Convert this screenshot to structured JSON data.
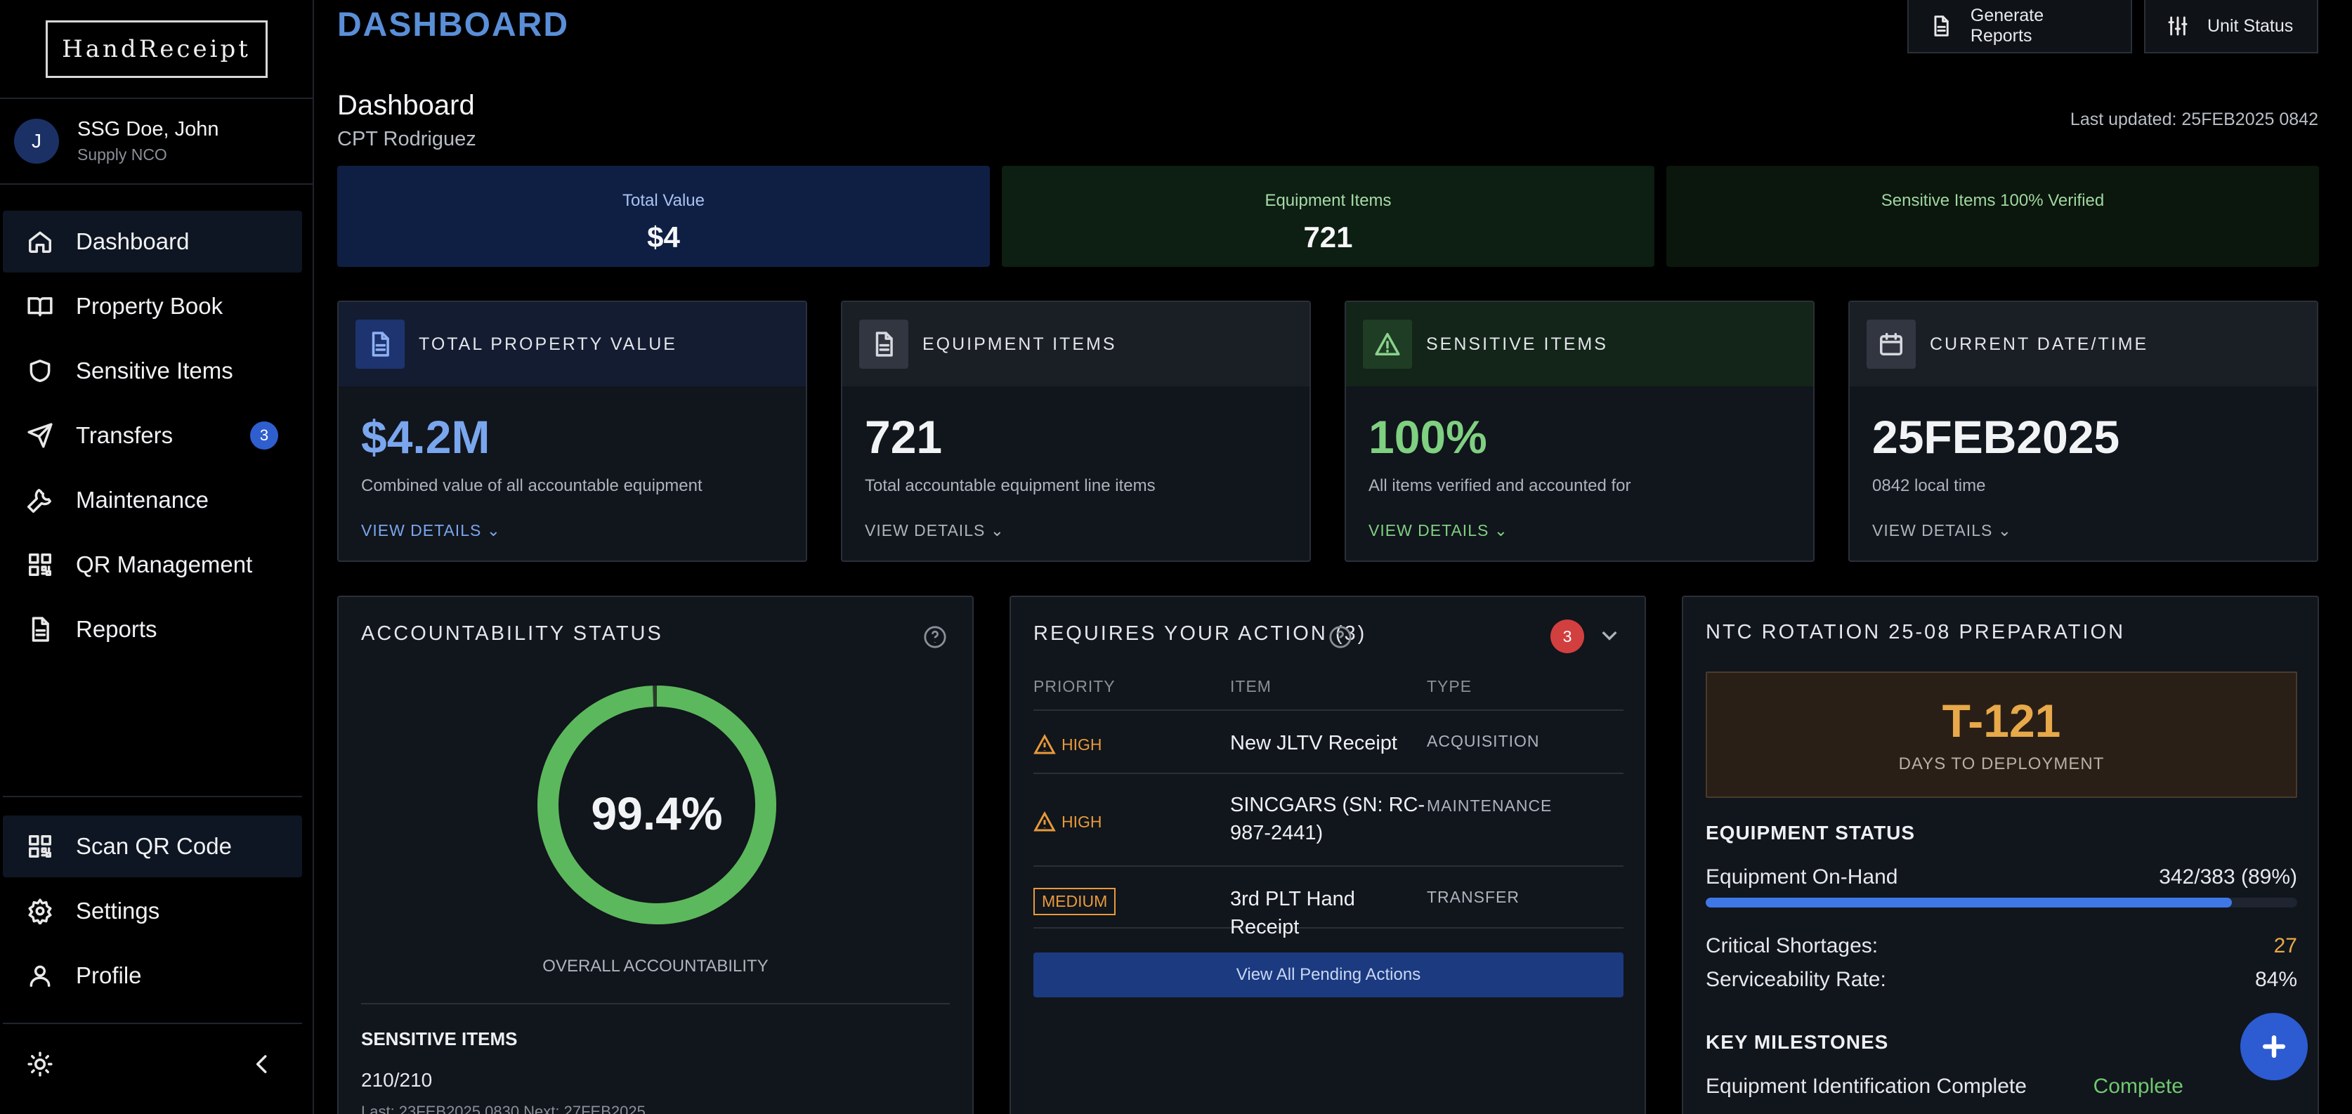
{
  "app": {
    "logo": "HandReceipt"
  },
  "user": {
    "initial": "J",
    "name": "SSG Doe, John",
    "role": "Supply NCO"
  },
  "sidebar": {
    "items": [
      {
        "label": "Dashboard",
        "icon": "home-icon",
        "active": true
      },
      {
        "label": "Property Book",
        "icon": "book-icon"
      },
      {
        "label": "Sensitive Items",
        "icon": "shield-icon"
      },
      {
        "label": "Transfers",
        "icon": "send-icon",
        "badge": "3"
      },
      {
        "label": "Maintenance",
        "icon": "wrench-icon"
      },
      {
        "label": "QR Management",
        "icon": "qr-icon"
      },
      {
        "label": "Reports",
        "icon": "file-icon"
      }
    ],
    "bottom_items": [
      {
        "label": "Scan QR Code",
        "icon": "qr-icon"
      },
      {
        "label": "Settings",
        "icon": "gear-icon"
      },
      {
        "label": "Profile",
        "icon": "user-icon"
      }
    ]
  },
  "header": {
    "page_title": "DASHBOARD",
    "generate_reports": "Generate Reports",
    "unit_status": "Unit Status"
  },
  "dashboard": {
    "title": "Dashboard",
    "subtitle": "CPT Rodriguez",
    "last_updated": "Last updated: 25FEB2025 0842"
  },
  "banners": [
    {
      "label": "Total Value",
      "value": "$4"
    },
    {
      "label": "Equipment Items",
      "value": "721"
    },
    {
      "label": "Sensitive Items 100% Verified",
      "value": ""
    }
  ],
  "stats": [
    {
      "title": "TOTAL PROPERTY VALUE",
      "value": "$4.2M",
      "desc": "Combined value of all accountable equipment",
      "link": "VIEW DETAILS",
      "icon": "document-icon"
    },
    {
      "title": "EQUIPMENT ITEMS",
      "value": "721",
      "desc": "Total accountable equipment line items",
      "link": "VIEW DETAILS",
      "icon": "document-icon"
    },
    {
      "title": "SENSITIVE ITEMS",
      "value": "100%",
      "desc": "All items verified and accounted for",
      "link": "VIEW DETAILS",
      "icon": "warning-icon"
    },
    {
      "title": "CURRENT DATE/TIME",
      "value": "25FEB2025",
      "desc": "0842 local time",
      "link": "VIEW DETAILS",
      "icon": "calendar-icon"
    }
  ],
  "accountability": {
    "title": "ACCOUNTABILITY STATUS",
    "percent_text": "99.4%",
    "percent": 99.4,
    "label": "OVERALL ACCOUNTABILITY",
    "sensitive_title": "SENSITIVE ITEMS",
    "sensitive_value": "210/210",
    "sensitive_schedule": "Last: 23FEB2025 0830 Next: 27FEB2025",
    "color": "#5cb85c"
  },
  "actions": {
    "title": "REQUIRES YOUR ACTION (3)",
    "count": "3",
    "headers": {
      "priority": "PRIORITY",
      "item": "ITEM",
      "type": "TYPE"
    },
    "rows": [
      {
        "priority": "HIGH",
        "item": "New JLTV Receipt",
        "type": "ACQUISITION"
      },
      {
        "priority": "HIGH",
        "item": "SINCGARS (SN: RC-987-2441)",
        "type": "MAINTENANCE"
      },
      {
        "priority": "MEDIUM",
        "item": "3rd PLT Hand Receipt",
        "type": "TRANSFER"
      }
    ],
    "view_all": "View All Pending Actions"
  },
  "ntc": {
    "title": "NTC ROTATION 25-08 PREPARATION",
    "countdown": "T-121",
    "countdown_label": "DAYS TO DEPLOYMENT",
    "equipment_status_title": "EQUIPMENT STATUS",
    "on_hand_label": "Equipment On-Hand",
    "on_hand_value": "342/383 (89%)",
    "on_hand_progress": 0.89,
    "shortages_label": "Critical Shortages:",
    "shortages_value": "27",
    "serviceability_label": "Serviceability Rate:",
    "serviceability_value": "84%",
    "milestones_title": "KEY MILESTONES",
    "milestone_1_label": "Equipment Identification Complete",
    "milestone_1_status": "Complete"
  }
}
